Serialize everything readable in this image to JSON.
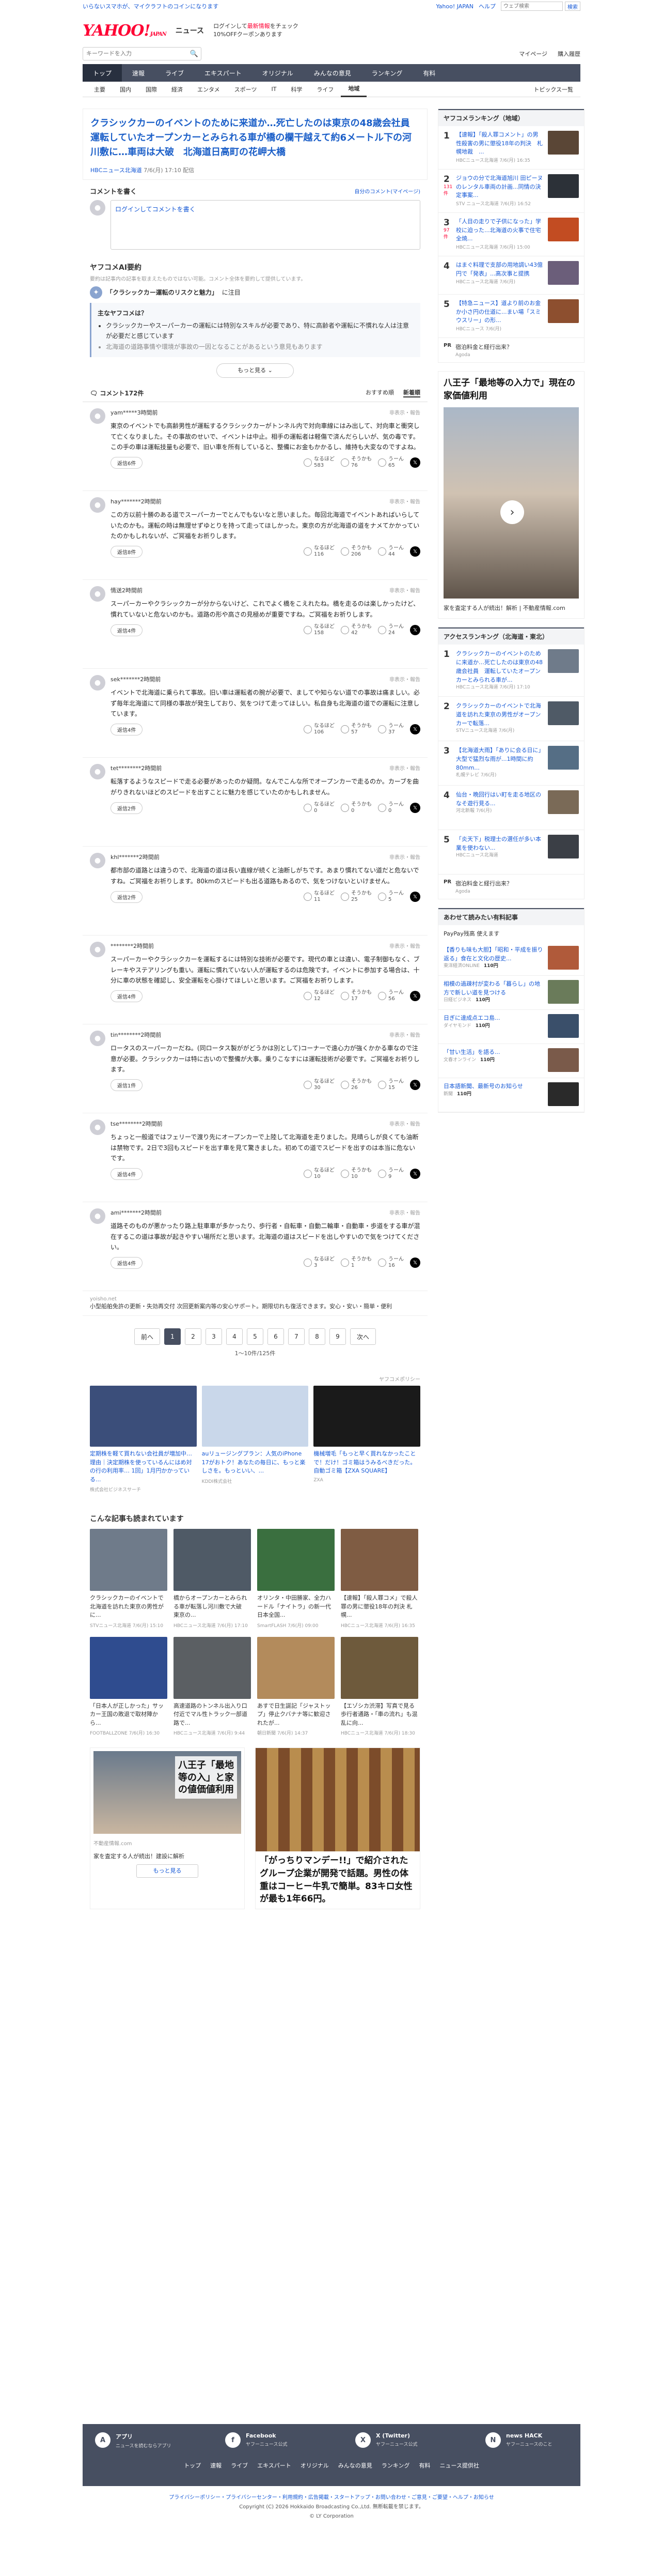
{
  "topbar": {
    "promo": "いらないスマホが、マイクラフトのコインになります",
    "links": [
      "Yahoo! JAPAN",
      "ヘルプ"
    ],
    "search_placeholder": "ウェブ検索",
    "search_button": "検索"
  },
  "brand": {
    "logo": "YAHOO!",
    "logo_sub": "JAPAN",
    "section": "ニュース",
    "message_line1": "ログインして",
    "message_red": "最新情報",
    "message_line2": "をチェック",
    "message_line3": "10%OFFクーポンあります"
  },
  "search": {
    "placeholder": "キーワードを入力",
    "links": [
      "マイページ",
      "購入履歴"
    ]
  },
  "nav": {
    "tabs": [
      "トップ",
      "速報",
      "ライブ",
      "エキスパート",
      "オリジナル",
      "みんなの意見",
      "ランキング",
      "有料"
    ],
    "active": 0
  },
  "subnav": {
    "items": [
      "主要",
      "国内",
      "国際",
      "経済",
      "エンタメ",
      "スポーツ",
      "IT",
      "科学",
      "ライフ",
      "地域"
    ],
    "active": 9,
    "right": "トピックス一覧"
  },
  "article": {
    "title": "クラシックカーのイベントのために来道か…死亡したのは東京の48歳会社員　運転していたオープンカーとみられる車が橋の欄干越えて約6メートル下の河川敷に…車両は大破　北海道日高町の花岬大橋",
    "source": "HBCニュース北海道",
    "date": "7/6(月) 17:10 配信"
  },
  "comment_form": {
    "title": "コメントを書く",
    "right_link": "自分のコメント(マイページ)",
    "placeholder": "ログインしてコメントを書く"
  },
  "ai": {
    "title": "ヤフコメAI要約",
    "sub": "要約は記事内の記事を取まえたものではない可能。コメント全体を要約して提供しています。",
    "topic_bold": "「クラシックカー運転のリスクと魅力」",
    "topic_rest": "に注目",
    "summary_head": "主なヤフコメは？",
    "points": [
      "クラシックカーやスーパーカーの運転には特別なスキルが必要であり、特に高齢者や運転に不慣れな人は注意が必要だと感じています",
      "北海道の道路事情や環境が事故の一因となることがあるという意見もあります"
    ],
    "more": "もっと見る"
  },
  "comments_header": {
    "count": "コメント172件",
    "sorts": [
      "おすすめ順",
      "新着順"
    ]
  },
  "comments": [
    {
      "name": "yam*****",
      "time": "3時間前",
      "report": "非表示・報告",
      "text": "東京のイベントでも高齢男性が運転するクラシックカーがトンネル内で対向車線にはみ出して、対向車と衝突して亡くなりました。その事故のせいで、イベントは中止。相手の運転者は軽傷で済んだらしいが、気の毒です。この手の車は運転技量も必要で、旧い車を所有していると、整備にお金もかかるし、維持も大変なのですよね。",
      "reply": "返信6件",
      "r1": "なるほど",
      "r1n": "583",
      "r2": "そうかも",
      "r2n": "76",
      "r3": "うーん",
      "r3n": "65"
    },
    {
      "name": "hay*******",
      "time": "2時間前",
      "report": "非表示・報告",
      "text": "この方以前十勝のある道でスーパーカーでとんでもないなと思いました。毎回北海道でイベントあればいらしていたのかも。運転の時は無理せずゆとりを持って走ってほしかった。東京の方が北海道の道をナメてかかっていたのかもしれないが、ご冥福をお祈りします。",
      "reply": "返信8件",
      "r1": "なるほど",
      "r1n": "116",
      "r2": "そうかも",
      "r2n": "206",
      "r3": "うーん",
      "r3n": "44"
    },
    {
      "name": "情送",
      "time": "2時間前",
      "report": "非表示・報告",
      "text": "スーパーカーやクラシックカーが分からないけど、これでよく橋をこえれたね。橋を走るのは楽しかったけど、慣れていないと危ないのかも。道路の形や高さの見極めが重要ですね。ご冥福をお祈りします。",
      "reply": "返信4件",
      "r1": "なるほど",
      "r1n": "158",
      "r2": "そうかも",
      "r2n": "42",
      "r3": "うーん",
      "r3n": "24"
    },
    {
      "name": "sek*******",
      "time": "2時間前",
      "report": "非表示・報告",
      "text": "イベントで北海道に乗られて事故。旧い車は運転者の腕が必要で、ましてや知らない道での事故は痛ましい。必ず毎年北海道にて同様の事故が発生しており、気をつけて走ってほしい。私自身も北海道の道での運転に注意しています。",
      "reply": "返信4件",
      "r1": "なるほど",
      "r1n": "106",
      "r2": "そうかも",
      "r2n": "57",
      "r3": "うーん",
      "r3n": "37"
    },
    {
      "name": "tet********",
      "time": "2時間前",
      "report": "非表示・報告",
      "text": "転落するようなスピードで走る必要があったのか疑問。なんでこんな所でオープンカーで走るのか。カーブを曲がりきれないほどのスピードを出すことに魅力を感じていたのかもしれません。",
      "reply": "返信2件",
      "r1": "なるほど",
      "r1n": "0",
      "r2": "そうかも",
      "r2n": "0",
      "r3": "うーん",
      "r3n": "0"
    },
    {
      "name": "khl*******",
      "time": "2時間前",
      "report": "非表示・報告",
      "text": "都市部の道路とは違うので、北海道の道は長い直線が続くと油断しがちです。あまり慣れてない道だと危ないですね。ご冥福をお祈りします。80kmのスピードも出る道路もあるので、気をつけないといけません。",
      "reply": "返信2件",
      "r1": "なるほど",
      "r1n": "11",
      "r2": "そうかも",
      "r2n": "25",
      "r3": "うーん",
      "r3n": "5"
    },
    {
      "name": "********",
      "time": "2時間前",
      "report": "非表示・報告",
      "text": "スーパーカーやクラシックカーを運転するには特別な技術が必要です。現代の車とは違い、電子制御もなく、ブレーキやステアリングも重い。運転に慣れていない人が運転するのは危険です。イベントに参加する場合は、十分に車の状態を確認し、安全運転を心掛けてほしいと思います。ご冥福をお祈りします。",
      "reply": "返信4件",
      "r1": "なるほど",
      "r1n": "12",
      "r2": "そうかも",
      "r2n": "17",
      "r3": "うーん",
      "r3n": "56"
    },
    {
      "name": "tin********",
      "time": "2時間前",
      "report": "非表示・報告",
      "text": "ロータスのスーパーカーだね。(同ロータス製ががどうかは別として)コーナーで遠心力が強くかかる車なので注意が必要。クラシックカーは特に古いので整備が大事。乗りこなすには運転技術が必要です。ご冥福をお祈りします。",
      "reply": "返信1件",
      "r1": "なるほど",
      "r1n": "30",
      "r2": "そうかも",
      "r2n": "26",
      "r3": "うーん",
      "r3n": "15"
    },
    {
      "name": "tse********",
      "time": "2時間前",
      "report": "非表示・報告",
      "text": "ちょっと一般道ではフェリーで渡り先にオープンカーで上陸して北海道を走りました。見晴らしが良くても油断は禁物です。2日で3回もスピードを出す車を見て驚きました。初めての道でスピードを出すのは本当に危ないです。",
      "reply": "返信4件",
      "r1": "なるほど",
      "r1n": "10",
      "r2": "そうかも",
      "r2n": "10",
      "r3": "うーん",
      "r3n": "9"
    },
    {
      "name": "ami*******",
      "time": "2時間前",
      "report": "非表示・報告",
      "text": "道路そのものが悪かったり路上駐車車が多かったり、歩行者・自転車・自動二輪車・自動車・歩道をする車が混在するこの道は事故が起きやすい場所だと思います。北海道の道はスピードを出しやすいので気をつけてください。",
      "reply": "返信4件",
      "r1": "なるほど",
      "r1n": "3",
      "r2": "そうかも",
      "r2n": "1",
      "r3": "うーん",
      "r3n": "16"
    }
  ],
  "inline_ad": {
    "src": "yoisho.net",
    "text": "小型船舶免許の更新・失効再交付 次回更新案内等の安心サポート。期限切れも復活できます。安心・安い・簡単・便利"
  },
  "pager": {
    "prev": "前へ",
    "pages": [
      "1",
      "2",
      "3",
      "4",
      "5",
      "6",
      "7",
      "8",
      "9"
    ],
    "next": "次へ",
    "count": "1〜10件/125件"
  },
  "promo": {
    "label": "ヤフコメポリシー",
    "cards": [
      {
        "title": "定期株を軽て買れない会社員が増加中…理由｜決定期株を使っているんにはめ対の行の利用率… 1回」1月円かかっている...",
        "src": "株式会社ビジネスサーチ",
        "color": "#3b4e7a"
      },
      {
        "title": "auリュージングプラン：人気のiPhone 17がおトク！あなたの毎日に、もっと楽しさを。もっといい、...",
        "src": "KDDI株式会社",
        "color": "#c9d7ea"
      },
      {
        "title": "機械増毛「もっと早く買れなかったことで！だけ！ゴミ箱はうみるべきだった。自動ゴミ箱【ZXA SQUARE】",
        "src": "ZXA",
        "color": "#1a1a1a"
      }
    ]
  },
  "recommend": {
    "title": "こんな記事も読まれています",
    "items": [
      {
        "title": "クラシックカーのイベントで北海道を訪れた東京の男性がに...",
        "src": "STVニュース北海道",
        "date": "7/6(月) 15:10",
        "color": "#6f7b8a"
      },
      {
        "title": "橋からオープンカーとみられる車が転落し河川敷で大破　東京の...",
        "src": "HBCニュース北海道",
        "date": "7/6(月) 17:10",
        "color": "#4f5a66"
      },
      {
        "title": "オリンタ・中田勝家、全力ハードル「ナイトラ」の新一代 日本全国...",
        "src": "SmartFLASH",
        "date": "7/6(月) 09:00",
        "color": "#3a6f3f"
      },
      {
        "title": "【速報】「殺人罪コメ」で殺人罪の男に懲役18年の判決 札幌...",
        "src": "HBCニュース北海道",
        "date": "7/6(月) 16:35",
        "color": "#7f5c43"
      },
      {
        "title": "「日本人が正しかった」サッカー王国の敗退で取材陣から...",
        "src": "FOOTBALLZONE",
        "date": "7/6(月) 16:30",
        "color": "#2f4c8f"
      },
      {
        "title": "高速道路のトンネル出入り口付近でマル性トラック一部道路で...",
        "src": "HBCニュース北海道",
        "date": "7/6(月) 9:44",
        "color": "#5b5f63"
      },
      {
        "title": "あすで日生誕記「ジャストップ」停止クバナナ等に歓迎されたが...",
        "src": "朝日新聞",
        "date": "7/6(月) 14:37",
        "color": "#b38b5c"
      },
      {
        "title": "【エゾシカ渋滞】写真で見る歩行者通路・「車の流れ」も混乱に向...",
        "src": "HBCニュース北海道",
        "date": "7/6(月) 18:30",
        "color": "#6e5a3c"
      }
    ]
  },
  "bottom_ad": {
    "left_caption": "八王子「最地等の入」と家の値価値利用",
    "left_src": "不動産情報.com",
    "left_text": "家を査定する人が続出！建設に解析",
    "left_btn": "もっと見る",
    "right_text": "「がっちりマンデー!!」で紹介されたグループ企業が開発で話題。男性の体重はコーヒー牛乳で簡単。83キロ女性が最も1年66円。"
  },
  "side_rank": {
    "title": "ヤフコメランキング（地域）",
    "items": [
      {
        "num": "1",
        "badge": "",
        "text": "【速報】「殺人罪コメント」の男性殺害の男に懲役18年の判決　札幌地裁　...",
        "src": "HBCニュース北海道 7/6(月) 16:35",
        "color": "#5a4636"
      },
      {
        "num": "2",
        "badge": "131 件",
        "text": "ジョウの分で北海道旭川 田ピーヌのレンタル車両の計画...同情の決定事案...",
        "src": "STV ニュース北海道 7/6(月) 16:52",
        "color": "#2c3138"
      },
      {
        "num": "3",
        "badge": "97 件",
        "text": "「人目の走りで子供になった」学校に迫った...北海道の火事で住宅全焼...",
        "src": "HBCニュース北海道 7/6(月) 15:00",
        "color": "#c24c22"
      },
      {
        "num": "4",
        "badge": "",
        "text": "はまぐ料理で支部の用地調い43億円で「発表」...高次事と提携",
        "src": "HBCニュース北海道 7/6(月)",
        "color": "#6b5e7a"
      },
      {
        "num": "5",
        "badge": "",
        "text": "【特急ニュース】道より前のお金か小さ円の仕道に...まい場「スミウスリー」の形...",
        "src": "HBCニュース 7/6(月)",
        "color": "#8d4f2f"
      }
    ],
    "pr": {
      "lab": "PR",
      "text": "宿泊料金と経行出来？",
      "src": "Agoda"
    }
  },
  "side_ad": {
    "head": "八王子「最地等の入力で」現在の家価値利用",
    "text": "家を査定する人が続出！解析 | 不動産情報.com"
  },
  "side_access": {
    "title": "アクセスランキング（北海道・東北）",
    "items": [
      {
        "num": "1",
        "text": "クラシックカーのイベントのために来道か…死亡したのは東京の48歳会社員　運転していたオープンカーとみられる車が...",
        "src": "HBCニュース北海道 7/6(月) 17:10",
        "color": "#6f7b8a"
      },
      {
        "num": "2",
        "text": "クラシックカーのイベントで北海道を訪れた東京の男性がオープンカーで転落...",
        "src": "STVニュース北海道 7/6(月)",
        "color": "#4f5a66"
      },
      {
        "num": "3",
        "text": "【北海道大雨】「ありに会る日に」大型で猛烈な雨が...1時間に約 80mm...",
        "src": "札幌テレビ 7/6(月)",
        "color": "#556e85"
      },
      {
        "num": "4",
        "text": "仙台・晩回行はい町を走る地区のなそ遊行見る...",
        "src": "河北新報 7/6(月)",
        "color": "#7a6a57"
      },
      {
        "num": "5",
        "text": "「炎天下」税理士の選任が多い本業を使わない...",
        "src": "HBCニュース北海道",
        "color": "#3b3f46"
      }
    ],
    "pr": {
      "lab": "PR",
      "text": "宿泊料金と経行出来？",
      "src": "Agoda"
    }
  },
  "side_links": {
    "title": "あわせて読みたい有料記事",
    "pay": "PayPay残高 使えます",
    "items": [
      {
        "text": "【香りも味も大胆】「昭和・平成を振り返る」食在と文化の歴史...",
        "src": "東洋経済ONLINE",
        "price": "110円",
        "color": "#b05a3a"
      },
      {
        "text": "相模の過疎村が変わる「暮らし」の地方で新しい道を見つける",
        "src": "日経ビジネス",
        "price": "110円",
        "color": "#6a7b5a"
      },
      {
        "text": "日ぎに達成点エコ島...",
        "src": "ダイヤモンド",
        "price": "110円",
        "color": "#3a4f6a"
      },
      {
        "text": "「甘い生活」を語る...",
        "src": "文春オンライン",
        "price": "110円",
        "color": "#7a5a4a"
      },
      {
        "text": "日本語新聞、最新号のお知らせ",
        "src": "新聞",
        "price": "110円",
        "color": "#2a2a2a"
      }
    ]
  },
  "footer": {
    "apps": [
      {
        "icon": "A",
        "title": "アプリ",
        "desc": "ニュースを読むならアプリ"
      },
      {
        "icon": "f",
        "title": "Facebook",
        "desc": "ヤフーニュース公式"
      },
      {
        "icon": "X",
        "title": "X (Twitter)",
        "desc": "ヤフーニュース公式"
      },
      {
        "icon": "N",
        "title": "news HACK",
        "desc": "ヤフーニュースのこと"
      }
    ],
    "nav": [
      "トップ",
      "速報",
      "ライブ",
      "エキスパート",
      "オリジナル",
      "みんなの意見",
      "ランキング",
      "有料",
      "ニュース提供社"
    ],
    "links": "プライバシーポリシー・プライバシーセンター・利用規約・広告掲載・スタートアップ・お問い合わせ・ご意見・ご要望・ヘルプ・お知らせ",
    "copyright": "Copyright (C) 2026 Hokkaido Broadcasting Co.,Ltd. 無断転載を禁じます。",
    "corp": "© LY Corporation"
  }
}
